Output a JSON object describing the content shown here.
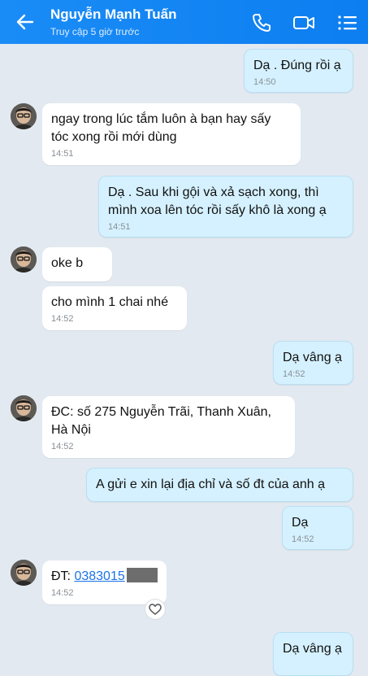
{
  "header": {
    "contact_name": "Nguyễn Mạnh Tuấn",
    "status": "Truy cập 5 giờ trước",
    "icons": [
      "back-arrow-icon",
      "phone-icon",
      "video-icon",
      "menu-icon"
    ],
    "accent_color": "#1a8cf6"
  },
  "messages": [
    {
      "sender": "me",
      "text": "Dạ . Đúng rồi ạ",
      "time": "14:50"
    },
    {
      "sender": "them",
      "lines": [
        "ngay trong lúc tắm luôn à bạn hay sấy",
        "tóc xong rồi mới dùng"
      ],
      "time": "14:51"
    },
    {
      "sender": "me",
      "lines": [
        "Dạ . Sau khi gội và xả sạch xong, thì",
        "mình xoa lên tóc rồi sấy khô là xong ạ"
      ],
      "time": "14:51"
    },
    {
      "sender": "them",
      "text": "oke b"
    },
    {
      "sender": "them",
      "text": "cho mình 1 chai nhé",
      "time": "14:52"
    },
    {
      "sender": "me",
      "text": "Dạ vâng ạ",
      "time": "14:52"
    },
    {
      "sender": "them",
      "lines": [
        "ĐC: số 275 Nguyễn Trãi, Thanh Xuân,",
        "Hà Nội"
      ],
      "time": "14:52"
    },
    {
      "sender": "me",
      "text": "A gửi e xin lại địa chỉ và số đt của anh ạ"
    },
    {
      "sender": "me",
      "text": "Dạ",
      "time": "14:52"
    },
    {
      "sender": "them",
      "prefix": "ĐT: ",
      "phone": "0383015",
      "time": "14:52"
    },
    {
      "sender": "me",
      "text": "Dạ vâng ạ"
    }
  ],
  "bubble_colors": {
    "me": "#d5f1ff",
    "them": "#ffffff",
    "background": "#e2e9f1"
  }
}
